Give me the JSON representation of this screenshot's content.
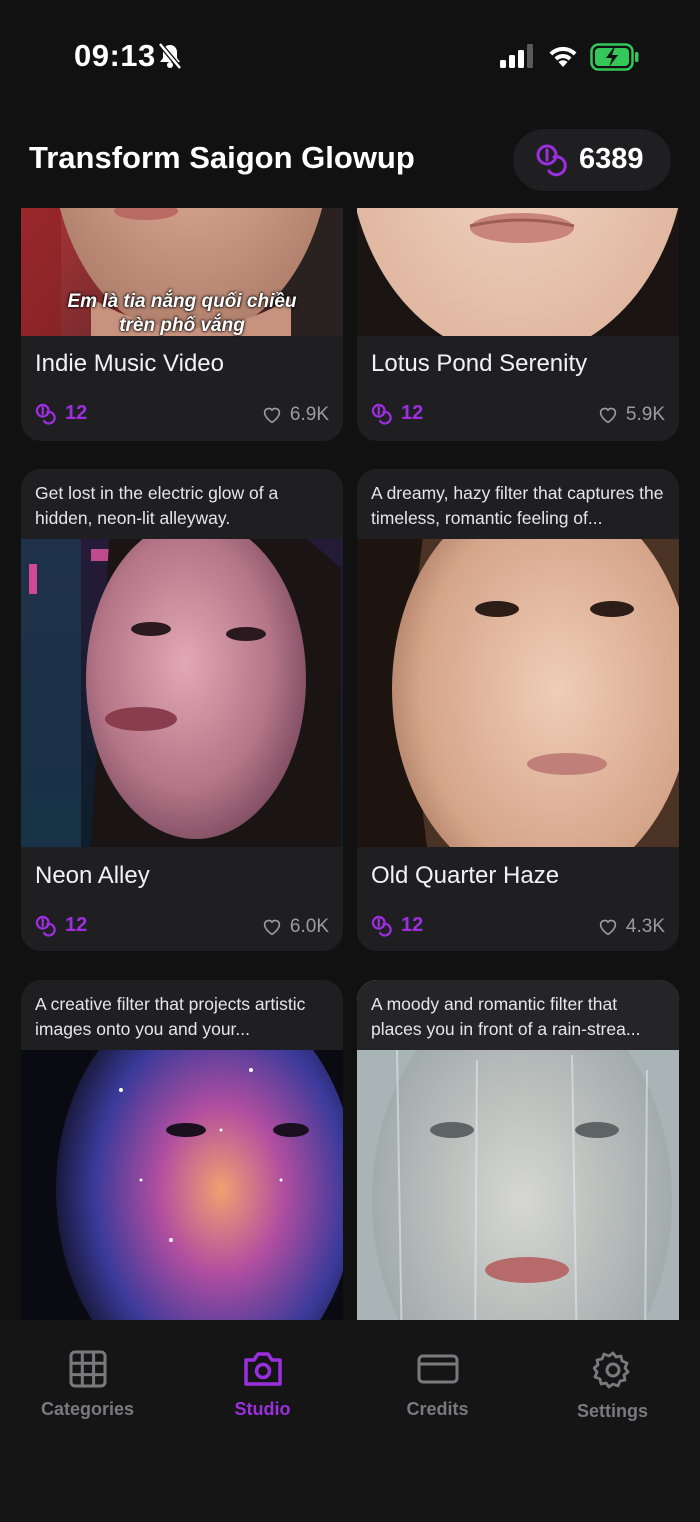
{
  "status_bar": {
    "time": "09:13"
  },
  "header": {
    "title": "Transform Saigon Glowup",
    "credits": "6389"
  },
  "cards": [
    {
      "title": "Indie Music Video",
      "price": "12",
      "likes": "6.9K",
      "caption_line1": "Em là tia nắng quối chiều",
      "caption_line2": "trèn phố vắng"
    },
    {
      "title": "Lotus Pond Serenity",
      "price": "12",
      "likes": "5.9K"
    },
    {
      "title": "Neon Alley",
      "price": "12",
      "likes": "6.0K",
      "description": "Get lost in the electric glow of a hidden, neon-lit alleyway."
    },
    {
      "title": "Old Quarter Haze",
      "price": "12",
      "likes": "4.3K",
      "description": "A dreamy, hazy filter that captures the timeless, romantic feeling of..."
    },
    {
      "description": "A creative filter that projects artistic images onto you and your..."
    },
    {
      "description": "A moody and romantic filter that places you in front of a rain-strea..."
    }
  ],
  "tabs": [
    {
      "label": "Categories",
      "icon": "grid-icon"
    },
    {
      "label": "Studio",
      "icon": "camera-icon",
      "active": true
    },
    {
      "label": "Credits",
      "icon": "credit-card-icon"
    },
    {
      "label": "Settings",
      "icon": "gear-icon"
    }
  ],
  "colors": {
    "accent": "#9b2fe0",
    "background": "#111112",
    "card": "#1f1f22"
  }
}
